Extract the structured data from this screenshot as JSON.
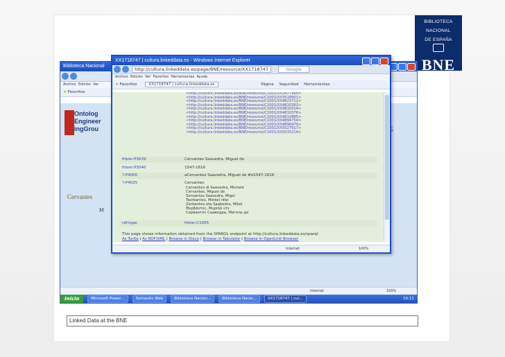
{
  "logo": {
    "lines": [
      "BIBLIOTECA",
      "NACIONAL",
      "DE ESPAÑA"
    ],
    "short": "BNE"
  },
  "outer_window": {
    "title": "Biblioteca Nacional",
    "menu": [
      "Archivo",
      "Edición",
      "Ver"
    ],
    "fav_label": "Favoritos",
    "org_logo_lines": [
      "Ontolog",
      "Engineer",
      "ingGrou"
    ],
    "cervantes_text": "Cervantes",
    "m_text": "M",
    "right_text": "as",
    "status_right": "Internet",
    "zoom": "100%",
    "taskbar": {
      "start": "Inicio",
      "tasks": [
        "Microsoft Power…",
        "Semantic Web",
        "Biblioteca Nacion…",
        "Biblioteca Nacio…",
        "XX1718747 | cul…"
      ],
      "clock": "10:11"
    }
  },
  "inner_window": {
    "title": "XX1718747 | cultura.linkeddata.es - Windows Internet Explorer",
    "address": "http://cultura.linkeddata.es/page/BNE/resource/XX1718747",
    "search_placeholder": "Google",
    "menu": [
      "Archivo",
      "Edición",
      "Ver",
      "Favoritos",
      "Herramientas",
      "Ayuda"
    ],
    "fav_label": "Favoritos",
    "tab_label": "XX1718747 | cultura.linkeddata.es",
    "toolbar": [
      "Página",
      "Seguridad",
      "Herramientas"
    ],
    "links": [
      "<http://cultura.linkeddata.es/BNE/resource/C1001/XX3477984>",
      "<http://cultura.linkeddata.es/BNE/resource/C1001/XX3518901>",
      "<http://cultura.linkeddata.es/BNE/resource/C1001/XX4623712>",
      "<http://cultura.linkeddata.es/BNE/resource/C1001/XX4810262>",
      "<http://cultura.linkeddata.es/BNE/resource/C1001/XX4810314>",
      "<http://cultura.linkeddata.es/BNE/resource/C1001/XX4810376>",
      "<http://cultura.linkeddata.es/BNE/resource/C1001/XX4812885>",
      "<http://cultura.linkeddata.es/BNE/resource/C1001/XX4894754>",
      "<http://cultura.linkeddata.es/BNE/resource/C1001/XX4896479>",
      "<http://cultura.linkeddata.es/BNE/resource/C1001/XX5027917>",
      "<http://cultura.linkeddata.es/BNE/resource/C1001/XX5035214>"
    ],
    "properties": [
      {
        "key": "frbrer:P3039",
        "value": "Cervantes Saavedra, Miguel de"
      },
      {
        "key": "frbrer:P3040",
        "value": "1547-1616"
      },
      {
        "key": "?:P4000",
        "value": "aCervantes Saavedra, Miguel de #d1547-1616"
      },
      {
        "key": "?:P4025",
        "value": "Cervantes."
      }
    ],
    "names": [
      "Cervantes di Saavedra, Michele",
      "Cervantes, Miguel de",
      "Servantes Saavedra, Migel",
      "Tserbantes, Minkel ntte",
      "Zerbantes eta Saabedra, Mikel",
      "Θερβάντες, Μιχαήλ ντε",
      "Сервантес Сааведра, Мигель де"
    ],
    "type_row": {
      "key": "rdf:type",
      "value": "frbrer:C1005"
    },
    "footer_note": "This page shows information obtained from the SPARQL endpoint at http://cultura.linkeddata.es/sparql.",
    "footer_links": [
      "As Turtle",
      "As RDF/XML",
      "Browse in Disco",
      "Browse in Tabulator",
      "Browse in OpenLink Browser"
    ],
    "status_right": "Internet",
    "zoom": "100%"
  },
  "caption": "Linked Data at the BNE"
}
